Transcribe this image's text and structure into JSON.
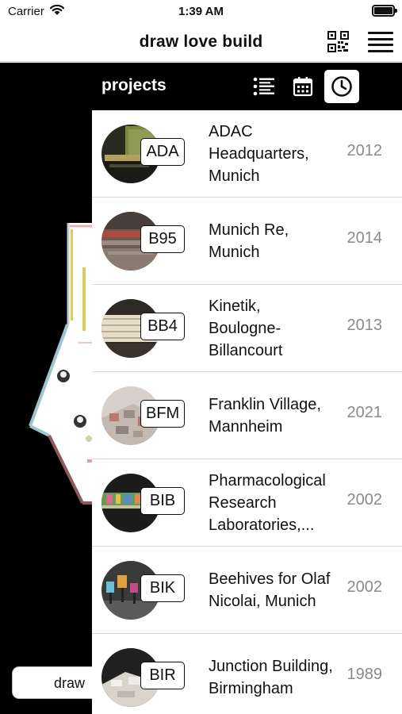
{
  "status_bar": {
    "carrier": "Carrier",
    "time": "1:39 AM"
  },
  "nav": {
    "title": "draw love build"
  },
  "draw_button": {
    "label": "draw"
  },
  "panel": {
    "title": "projects"
  },
  "colors": {
    "black": "#000000",
    "white": "#ffffff",
    "year_gray": "#8a8a8a"
  },
  "projects": [
    {
      "code": "ADA",
      "name": "ADAC Headquarters, Munich",
      "year": "2012"
    },
    {
      "code": "B95",
      "name": "Munich Re, Munich",
      "year": "2014"
    },
    {
      "code": "BB4",
      "name": "Kinetik, Boulogne-Billancourt",
      "year": "2013"
    },
    {
      "code": "BFM",
      "name": "Franklin Village, Mannheim",
      "year": "2021"
    },
    {
      "code": "BIB",
      "name": "Pharmacological Research Laboratories,...",
      "year": "2002"
    },
    {
      "code": "BIK",
      "name": "Beehives for Olaf Nicolai, Munich",
      "year": "2002"
    },
    {
      "code": "BIR",
      "name": "Junction Building, Birmingham",
      "year": "1989"
    }
  ]
}
